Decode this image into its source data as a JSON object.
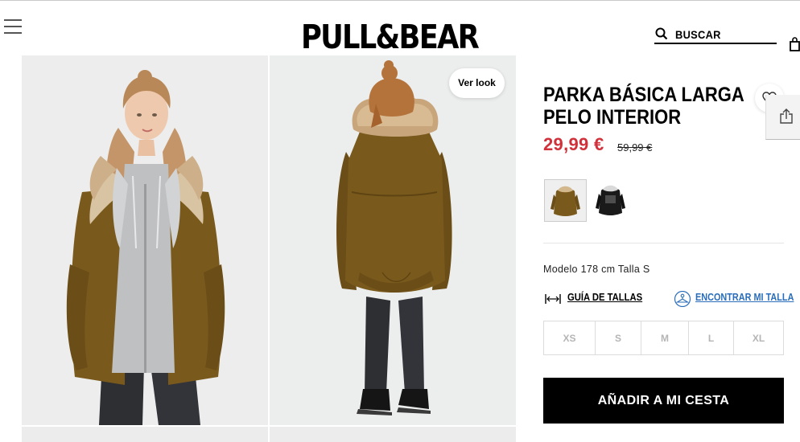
{
  "header": {
    "brand": "PULL&BEAR",
    "search_label": "BUSCAR"
  },
  "gallery": {
    "ver_look_label": "Ver look"
  },
  "product": {
    "title_line1": "PARKA BÁSICA LARGA",
    "title_line2": "PELO INTERIOR",
    "price": "29,99 €",
    "old_price": "59,99 €",
    "colors": [
      "khaki",
      "black"
    ],
    "model_info": "Modelo 178 cm Talla S",
    "size_guide_label": "GUÍA DE TALLAS",
    "find_size_label": "ENCONTRAR MI TALLA",
    "sizes": [
      "XS",
      "S",
      "M",
      "L",
      "XL"
    ],
    "add_to_cart_label": "AÑADIR A MI CESTA"
  },
  "colors": {
    "price_red": "#d0313b",
    "link_blue": "#2a6ebb",
    "button_black": "#000000",
    "parka_khaki": "#7a5a1c"
  }
}
